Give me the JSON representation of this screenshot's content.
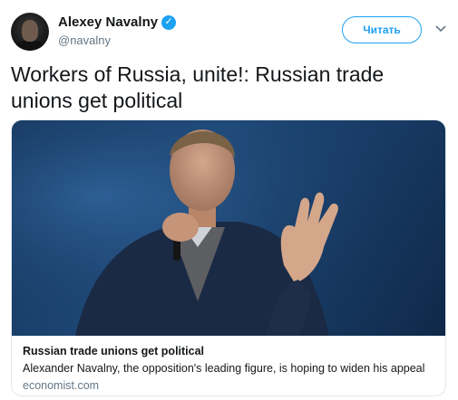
{
  "author": {
    "name": "Alexey Navalny",
    "handle": "@navalny",
    "verified_icon": "verified-badge-icon"
  },
  "actions": {
    "follow_label": "Читать",
    "menu_icon": "chevron-down-icon"
  },
  "tweet": {
    "text": "Workers of Russia, unite!: Russian trade unions get political"
  },
  "card": {
    "title": "Russian trade unions get political",
    "description": "Alexander Navalny, the opposition's leading figure, is hoping to widen his appeal",
    "domain": "economist.com"
  },
  "colors": {
    "accent": "#1da1f2",
    "text": "#14171a",
    "muted": "#657786",
    "border": "#e1e8ed"
  }
}
